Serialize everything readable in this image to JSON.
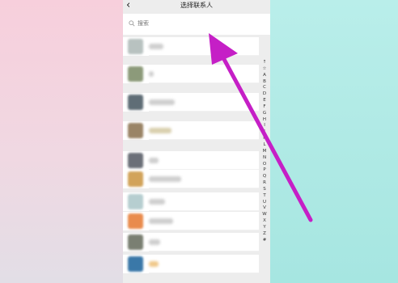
{
  "header": {
    "title": "选择联系人",
    "back_icon": "chevron-left-icon"
  },
  "search": {
    "placeholder": "搜索",
    "icon": "search-icon"
  },
  "alphabet_index": [
    "↑",
    "☆",
    "A",
    "B",
    "C",
    "D",
    "E",
    "F",
    "G",
    "H",
    "I",
    "J",
    "K",
    "L",
    "M",
    "N",
    "O",
    "P",
    "Q",
    "R",
    "S",
    "T",
    "U",
    "V",
    "W",
    "X",
    "Y",
    "Z",
    "#"
  ],
  "contacts_note": "contact names blurred",
  "colors": {
    "annotation_arrow": "#c51fc6",
    "accent_bg_left": "#f7d3de",
    "accent_bg_right": "#b4ece7"
  }
}
